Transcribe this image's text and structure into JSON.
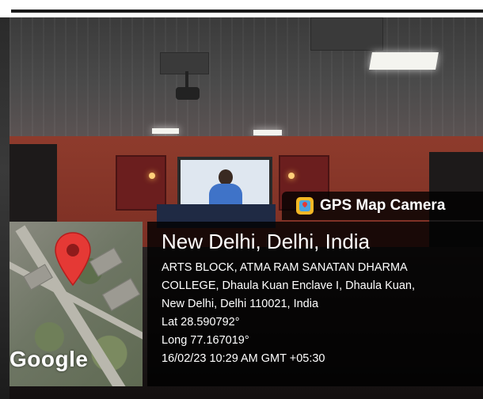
{
  "badge": {
    "app_name": "GPS Map Camera",
    "icon": "gps-map-camera-app-icon"
  },
  "map": {
    "logo_text": "Google",
    "pin_icon": "map-pin-icon",
    "pin_color": "#e53935"
  },
  "location": {
    "title": "New Delhi, Delhi, India",
    "address_line_1": "ARTS BLOCK, ATMA RAM SANATAN DHARMA",
    "address_line_2": "COLLEGE, Dhaula Kuan Enclave I, Dhaula Kuan,",
    "address_line_3": "New Delhi, Delhi 110021, India",
    "latitude": "Lat 28.590792°",
    "longitude": "Long 77.167019°",
    "timestamp": "16/02/23 10:29 AM GMT +05:30"
  },
  "colors": {
    "overlay_bg": "#000000",
    "wall_red": "#8e3b2c",
    "screen_blue": "#3f73c8",
    "badge_icon_yellow": "#f3b825"
  }
}
